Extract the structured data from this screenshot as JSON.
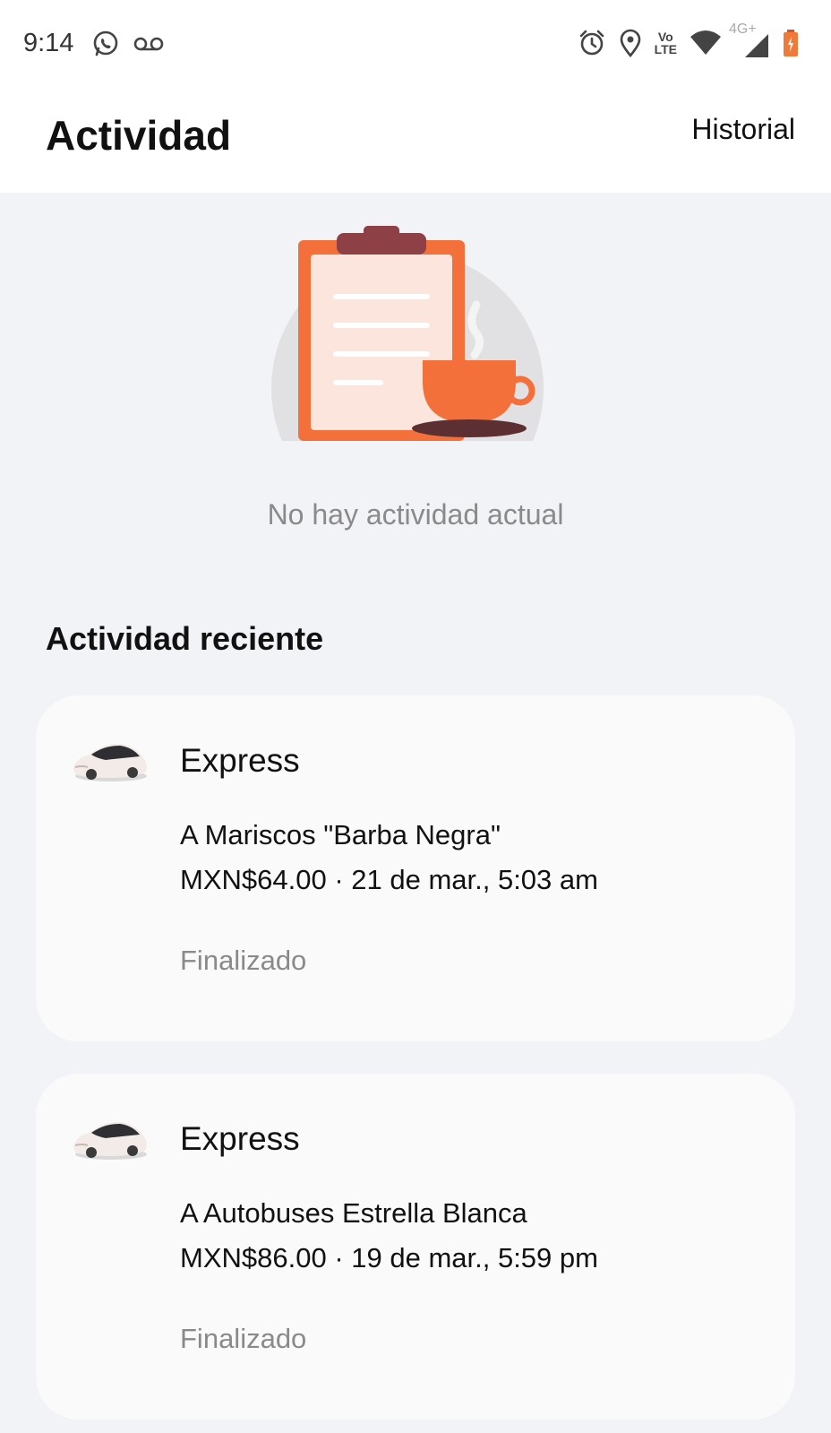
{
  "status_bar": {
    "time": "9:14",
    "left_icons": [
      "whatsapp-icon",
      "voicemail-icon"
    ],
    "right_icons": [
      "alarm-icon",
      "location-icon",
      "volte-icon",
      "wifi-icon",
      "signal-4g-icon",
      "battery-icon"
    ],
    "network_label": "4G+",
    "volte_label_top": "Vo",
    "volte_label_bottom": "LTE"
  },
  "header": {
    "title": "Actividad",
    "history_label": "Historial"
  },
  "empty_state": {
    "message": "No hay actividad actual",
    "illustration": "clipboard-coffee-illustration"
  },
  "recent": {
    "section_title": "Actividad reciente",
    "items": [
      {
        "type": "Express",
        "destination": "A Mariscos \"Barba Negra\"",
        "meta": "MXN$64.00 · 21 de mar., 5:03 am",
        "status": "Finalizado"
      },
      {
        "type": "Express",
        "destination": "A Autobuses Estrella Blanca",
        "meta": "MXN$86.00 · 19 de mar., 5:59 pm",
        "status": "Finalizado"
      }
    ]
  },
  "colors": {
    "background": "#f2f3f7",
    "card": "#fafafa",
    "accent_orange": "#f4703a",
    "muted_text": "#8a8a8a"
  }
}
